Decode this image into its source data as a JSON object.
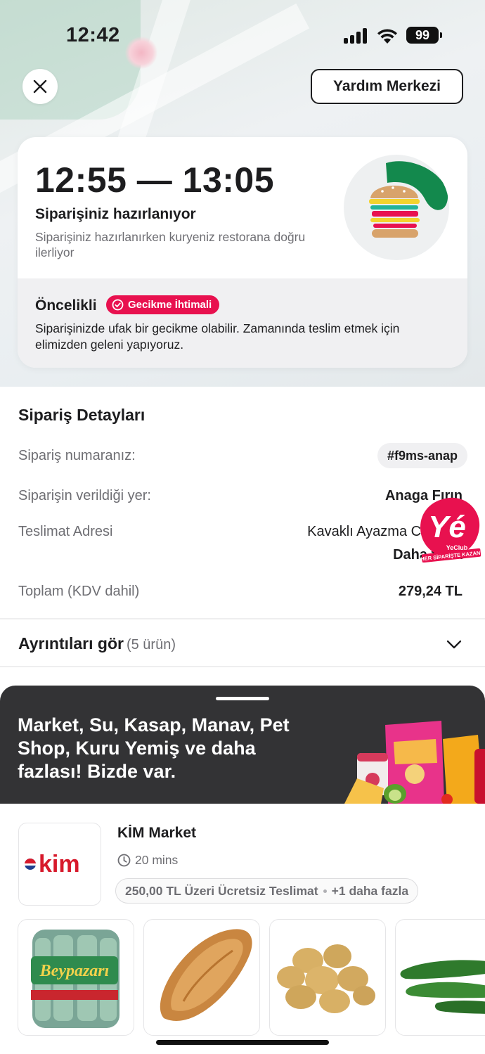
{
  "status_bar": {
    "time": "12:42",
    "battery": "99"
  },
  "header": {
    "help_label": "Yardım Merkezi"
  },
  "status_card": {
    "eta": "12:55 — 13:05",
    "title": "Siparişiniz hazırlanıyor",
    "subtitle": "Siparişiniz hazırlanırken kuryeniz restorana doğru ilerliyor",
    "priority_label": "Öncelikli",
    "delay_badge": "Gecikme İhtimali",
    "priority_text": "Siparişinizde ufak bir gecikme olabilir. Zamanında teslim etmek için elimizden geleni yapıyoruz."
  },
  "order_details": {
    "title": "Sipariş Detayları",
    "order_number_label": "Sipariş numaranız:",
    "order_number": "#f9ms-anap",
    "place_label": "Siparişin verildiği yer:",
    "place_value": "Anaga Fırın",
    "address_label": "Teslimat Adresi",
    "address_value": "Kavaklı Ayazma Caddesi",
    "address_more": "Daha fazla",
    "total_label": "Toplam (KDV dahil)",
    "total_value": "279,24 TL",
    "items_toggle_label": "Ayrıntıları gör",
    "items_count": "(5 ürün)"
  },
  "yeclub": {
    "logo_text": "Yé",
    "brand": "YeClub",
    "slogan": "HER SİPARİŞTE KAZAN!"
  },
  "promo": {
    "text": "Market, Su, Kasap, Manav, Pet Shop, Kuru Yemiş ve daha fazlası! Bizde var."
  },
  "store": {
    "logo_text": "kim",
    "name": "KİM Market",
    "delivery_time": "20 mins",
    "free_delivery": "250,00 TL Üzeri Ücretsiz Teslimat",
    "more": "+1 daha fazla"
  },
  "products": [
    {
      "icon": "water-bottles",
      "brand": "Beypazarı"
    },
    {
      "icon": "bread"
    },
    {
      "icon": "potatoes"
    },
    {
      "icon": "cucumbers"
    }
  ],
  "colors": {
    "accent": "#e8114f",
    "promo_bg": "#333335",
    "text": "#1d1d1f",
    "muted": "#6e6e73"
  }
}
